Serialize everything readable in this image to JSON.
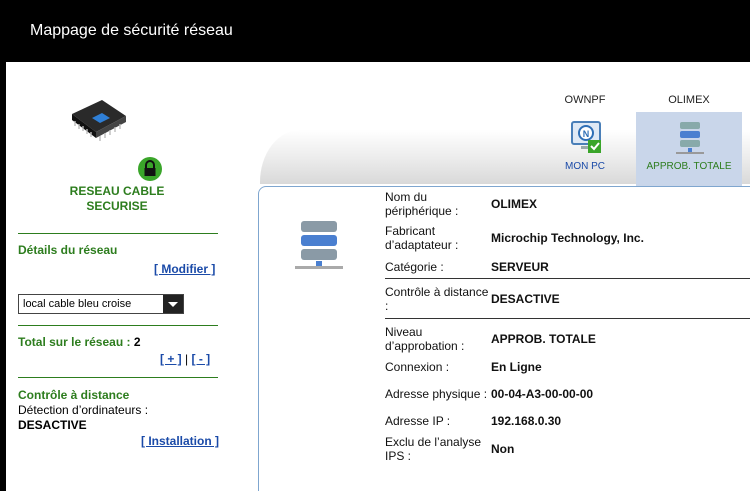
{
  "window": {
    "title": "Mappage de sécurité réseau"
  },
  "left": {
    "status_line1": "RESEAU CABLE",
    "status_line2": "SECURISE",
    "details_title": "Détails du réseau",
    "modify_link": "[ Modifier ]",
    "network_select": "local cable bleu croise",
    "total_label": "Total sur le réseau :",
    "total_value": "2",
    "add_link": "[ + ]",
    "sep": "|",
    "remove_link": "[ - ]",
    "remote_title": "Contrôle à distance",
    "detection_label": "Détection d’ordinateurs :",
    "detection_value": "DESACTIVE",
    "install_link": "[ Installation ]"
  },
  "devices": [
    {
      "name": "OWNPF",
      "label": "MON PC",
      "icon": "monitor-check-icon",
      "selected": false
    },
    {
      "name": "OLIMEX",
      "label": "APPROB. TOTALE",
      "icon": "server-icon",
      "selected": true
    }
  ],
  "details": {
    "rows": [
      {
        "label": "Nom du périphérique :",
        "value": "OLIMEX"
      },
      {
        "label": "Fabricant d’adaptateur :",
        "value": "Microchip Technology, Inc."
      },
      {
        "label": "Catégorie :",
        "value": "SERVEUR"
      },
      {
        "label": "Contrôle à distance :",
        "value": "DESACTIVE"
      },
      {
        "label": "Niveau d’approbation :",
        "value": "APPROB. TOTALE"
      },
      {
        "label": "Connexion :",
        "value": "En Ligne"
      },
      {
        "label": "Adresse physique :",
        "value": "00-04-A3-00-00-00"
      },
      {
        "label": "Adresse IP :",
        "value": "192.168.0.30"
      },
      {
        "label": "Exclu de l’analyse IPS :",
        "value": "Non"
      }
    ]
  },
  "colors": {
    "accent_green": "#2d7d1e",
    "link_blue": "#1a4aa8",
    "selected_bg": "#c9d6ea"
  }
}
